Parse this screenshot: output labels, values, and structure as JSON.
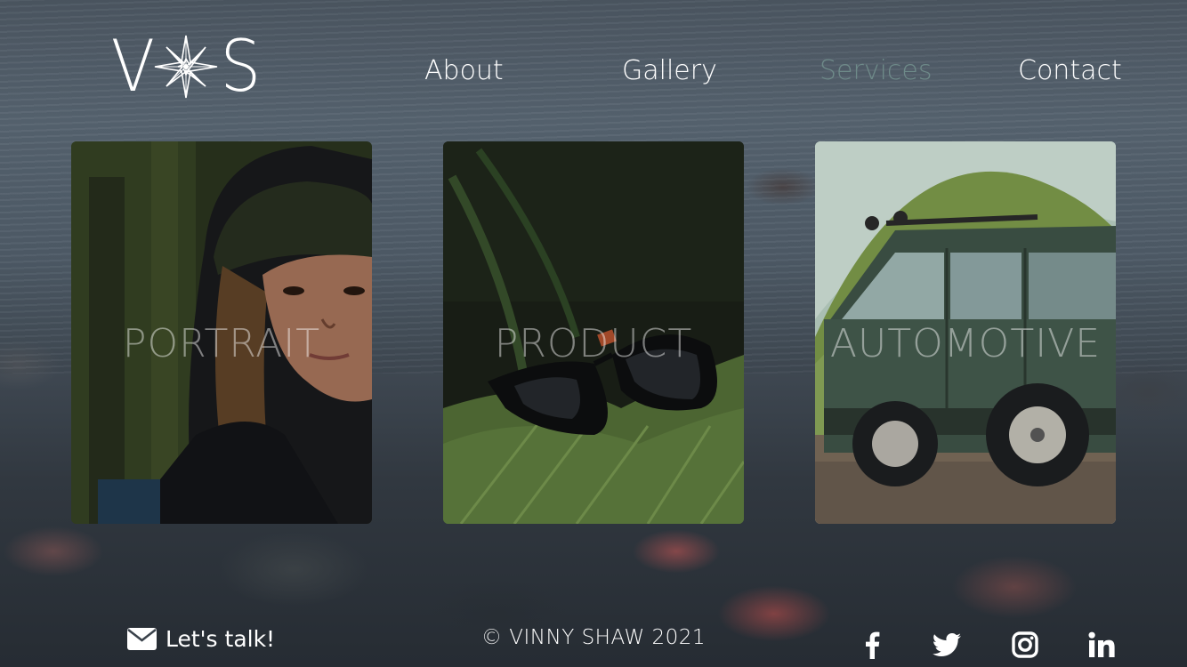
{
  "logo": {
    "left_letter": "V",
    "right_letter": "S",
    "mark_icon": "compass-star-icon"
  },
  "nav": {
    "items": [
      {
        "label": "About"
      },
      {
        "label": "Gallery"
      },
      {
        "label": "Services",
        "active": true
      },
      {
        "label": "Contact"
      }
    ]
  },
  "cards": [
    {
      "label": "PORTRAIT"
    },
    {
      "label": "PRODUCT"
    },
    {
      "label": "AUTOMOTIVE"
    }
  ],
  "footer": {
    "talk_icon": "envelope-icon",
    "talk_label": "Let's talk!",
    "copyright": "© VINNY SHAW 2021",
    "social": [
      "facebook-icon",
      "twitter-icon",
      "instagram-icon",
      "linkedin-icon"
    ]
  },
  "colors": {
    "active_nav": "#6e8a89",
    "text": "#ffffff"
  }
}
